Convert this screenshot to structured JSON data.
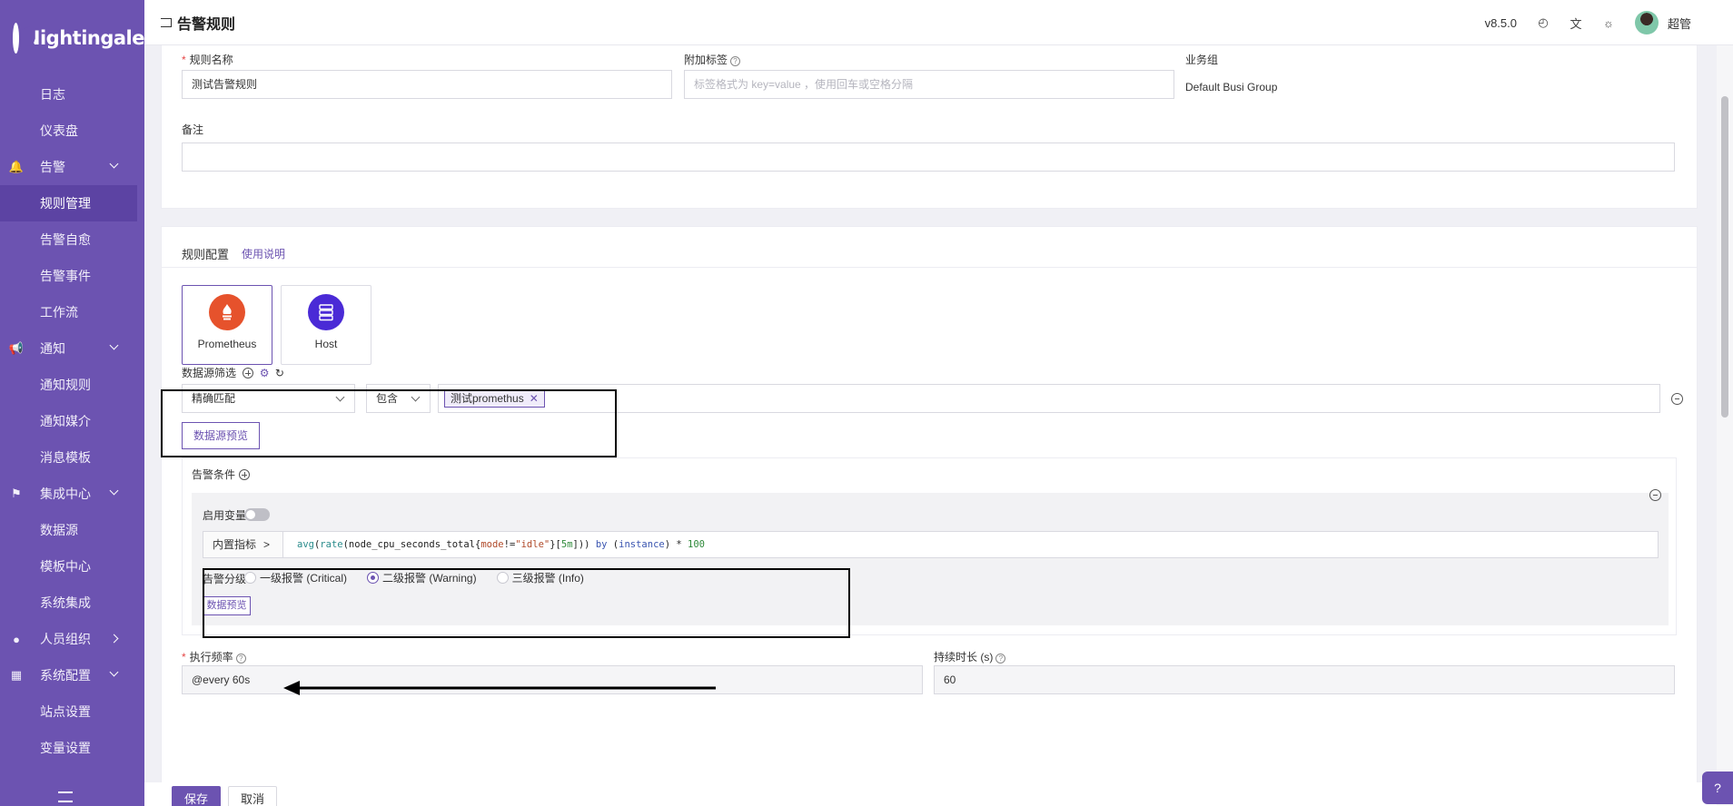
{
  "app": {
    "logo_text": "Nightingale",
    "version": "v8.5.0",
    "user": "超管"
  },
  "header": {
    "title": "告警规则"
  },
  "sidebar": {
    "items": [
      {
        "label": "日志",
        "type": "sub"
      },
      {
        "label": "仪表盘",
        "type": "sub"
      },
      {
        "label": "告警",
        "type": "group",
        "icon": "bell-icon"
      },
      {
        "label": "规则管理",
        "type": "sub",
        "active": true
      },
      {
        "label": "告警自愈",
        "type": "sub"
      },
      {
        "label": "告警事件",
        "type": "sub"
      },
      {
        "label": "工作流",
        "type": "sub"
      },
      {
        "label": "通知",
        "type": "group",
        "icon": "megaphone-icon"
      },
      {
        "label": "通知规则",
        "type": "sub"
      },
      {
        "label": "通知媒介",
        "type": "sub"
      },
      {
        "label": "消息模板",
        "type": "sub"
      },
      {
        "label": "集成中心",
        "type": "group",
        "icon": "integration-icon"
      },
      {
        "label": "数据源",
        "type": "sub"
      },
      {
        "label": "模板中心",
        "type": "sub"
      },
      {
        "label": "系统集成",
        "type": "sub"
      },
      {
        "label": "人员组织",
        "type": "group",
        "icon": "user-icon"
      },
      {
        "label": "系统配置",
        "type": "group",
        "icon": "grid-icon"
      },
      {
        "label": "站点设置",
        "type": "sub"
      },
      {
        "label": "变量设置",
        "type": "sub"
      }
    ]
  },
  "basic": {
    "rule_name_label": "规则名称",
    "rule_name_value": "测试告警规则",
    "tags_label": "附加标签",
    "tags_placeholder": "标签格式为 key=value ，使用回车或空格分隔",
    "busi_group_label": "业务组",
    "busi_group_value": "Default Busi Group",
    "note_label": "备注",
    "note_value": ""
  },
  "rule_config": {
    "title": "规则配置",
    "help_link": "使用说明",
    "datasource_types": [
      {
        "name": "Prometheus",
        "selected": true,
        "color": "#e6522c"
      },
      {
        "name": "Host",
        "selected": false,
        "color": "#4a2ad6"
      }
    ],
    "ds_filter_label": "数据源筛选",
    "match_mode": "精确匹配",
    "operator": "包含",
    "selected_datasource": "测试promethus",
    "ds_preview_button": "数据源预览",
    "condition_label": "告警条件",
    "enable_var_label": "启用变量",
    "enable_var_on": false,
    "metric_button": "内置指标",
    "query_parts": [
      {
        "t": "avg",
        "c": "c-fn"
      },
      {
        "t": "(",
        "c": "c-tx"
      },
      {
        "t": "rate",
        "c": "c-fn"
      },
      {
        "t": "(",
        "c": "c-tx"
      },
      {
        "t": "node_cpu_seconds_total",
        "c": "c-tx"
      },
      {
        "t": "{",
        "c": "c-tx"
      },
      {
        "t": "mode",
        "c": "c-str"
      },
      {
        "t": "!=",
        "c": "c-tx"
      },
      {
        "t": "\"idle\"",
        "c": "c-str"
      },
      {
        "t": "}[",
        "c": "c-tx"
      },
      {
        "t": "5m",
        "c": "c-num"
      },
      {
        "t": "])) ",
        "c": "c-tx"
      },
      {
        "t": "by",
        "c": "c-kw"
      },
      {
        "t": " (",
        "c": "c-tx"
      },
      {
        "t": "instance",
        "c": "c-kw"
      },
      {
        "t": ") * ",
        "c": "c-tx"
      },
      {
        "t": "100",
        "c": "c-num"
      }
    ],
    "severity_label": "告警分级",
    "severities": [
      {
        "label": "一级报警 (Critical)",
        "checked": false
      },
      {
        "label": "二级报警 (Warning)",
        "checked": true
      },
      {
        "label": "三级报警 (Info)",
        "checked": false
      }
    ],
    "data_preview_button": "数据预览",
    "exec_freq_label": "执行频率",
    "exec_freq_value": "@every 60s",
    "duration_label": "持续时长 (s)",
    "duration_value": "60"
  },
  "footer": {
    "save": "保存",
    "cancel": "取消"
  }
}
